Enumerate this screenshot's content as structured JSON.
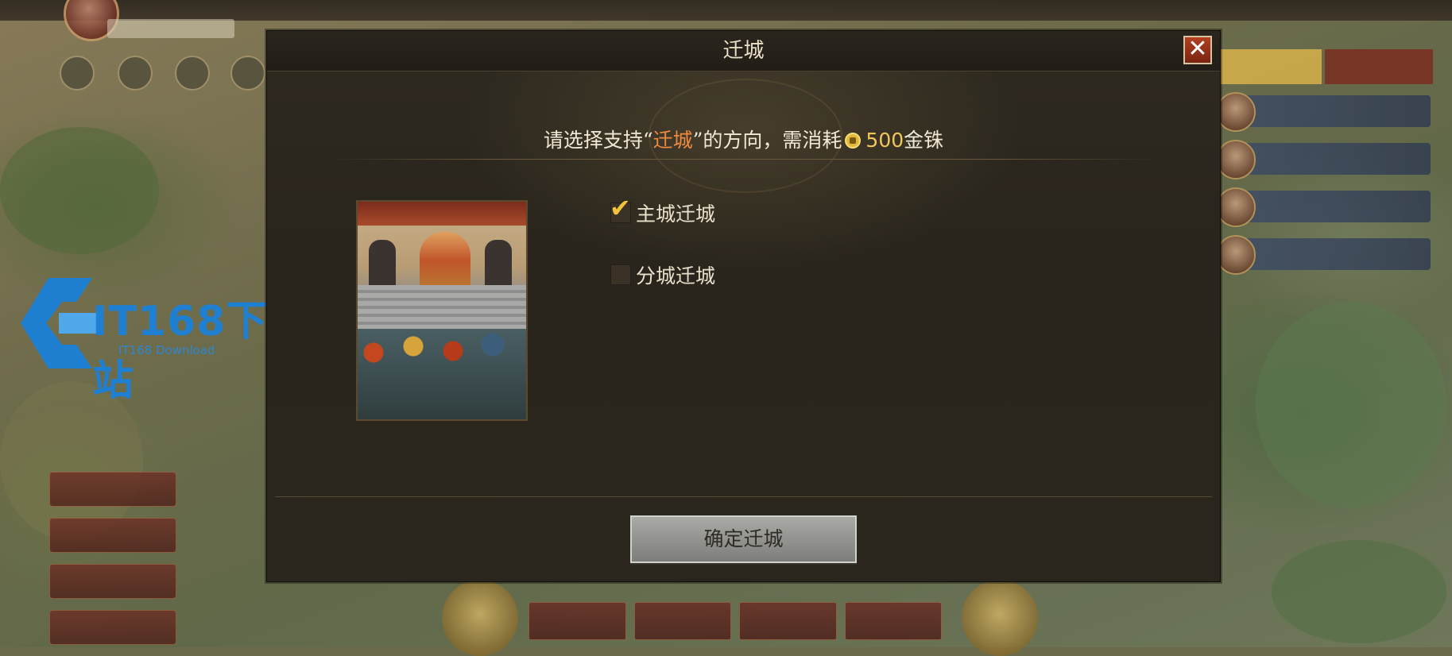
{
  "dialog": {
    "title": "迁城",
    "close_symbol": "✕",
    "instruction": {
      "prefix": "请选择支持“",
      "highlight": "迁城",
      "suffix": "”的方向，需消耗",
      "amount": "500",
      "unit": "金铢"
    },
    "options": [
      {
        "label": "主城迁城",
        "checked": true
      },
      {
        "label": "分城迁城",
        "checked": false
      }
    ],
    "confirm_label": "确定迁城",
    "highlight_color": "#ef8a40",
    "coin_icon": "gold-coin-icon"
  },
  "watermark": {
    "logo": "IT168下载站",
    "subtitle": "IT168 Download"
  }
}
